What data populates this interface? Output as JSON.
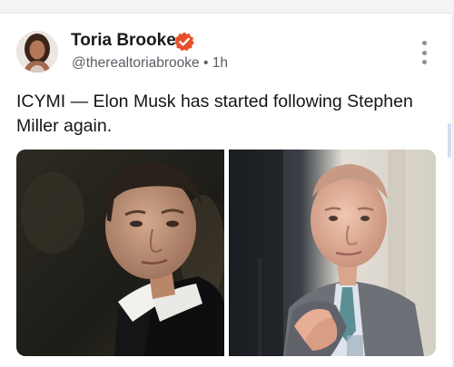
{
  "post": {
    "author": {
      "name": "Toria Brooke",
      "handle": "@therealtoriabrooke",
      "time": "1h",
      "separator": "•",
      "verified": true,
      "avatar_icon": "profile-photo"
    },
    "text": "ICYMI — Elon Musk has started following Stephen Miller again.",
    "images": [
      {
        "subject_icon": "man-in-tuxedo-photo"
      },
      {
        "subject_icon": "man-in-suit-clapping-photo"
      }
    ],
    "more_icon": "vertical-ellipsis-icon"
  },
  "colors": {
    "verified_badge": "#e8502a",
    "text_primary": "#151515",
    "text_secondary": "#5c5c66",
    "scroll_thumb": "#d7dcf0"
  }
}
